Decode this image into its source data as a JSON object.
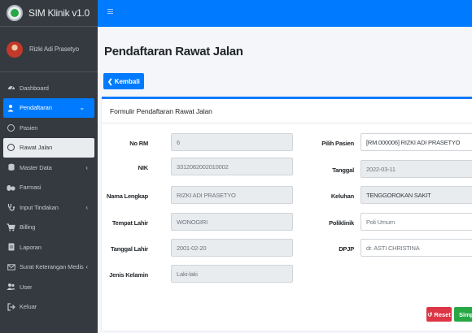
{
  "app": {
    "title": "SIM Klinik v1.0"
  },
  "user": {
    "name": "Rizki Adi Prasetyo"
  },
  "sidebar": {
    "items": [
      {
        "label": "Dashboard",
        "icon": "gauge-icon"
      },
      {
        "label": "Pendaftaran",
        "icon": "user-plus-icon"
      },
      {
        "label": "Pasien",
        "icon": "circle-icon"
      },
      {
        "label": "Rawat Jalan",
        "icon": "circle-icon"
      },
      {
        "label": "Master Data",
        "icon": "database-icon"
      },
      {
        "label": "Farmasi",
        "icon": "pills-icon"
      },
      {
        "label": "Input Tindakan",
        "icon": "stethoscope-icon"
      },
      {
        "label": "Billing",
        "icon": "cart-icon"
      },
      {
        "label": "Laporan",
        "icon": "file-icon"
      },
      {
        "label": "Surat Keterangan Medis",
        "icon": "envelope-icon"
      },
      {
        "label": "User",
        "icon": "users-icon"
      },
      {
        "label": "Keluar",
        "icon": "sign-out-icon"
      }
    ]
  },
  "page": {
    "title": "Pendaftaran Rawat Jalan",
    "back_label": "Kembali"
  },
  "form": {
    "header": "Formulir Pendaftaran Rawat Jalan",
    "left": [
      {
        "label": "No RM",
        "value": "6"
      },
      {
        "label": "NIK",
        "value": "3312082002010002"
      },
      {
        "label": "Nama Lengkap",
        "value": "RIZKI ADI PRASETYO"
      },
      {
        "label": "Tempat Lahir",
        "value": "WONOGIRI"
      },
      {
        "label": "Tanggal Lahir",
        "value": "2001-02-20"
      },
      {
        "label": "Jenis Kelamin",
        "value": "Laki-laki"
      }
    ],
    "right": [
      {
        "label": "Pilih Pasien",
        "value": "[RM.000006] RIZKI ADI PRASETYO"
      },
      {
        "label": "Tanggal",
        "value": "2022-03-11"
      },
      {
        "label": "Keluhan",
        "value": "TENGGOROKAN SAKIT"
      },
      {
        "label": "Poliklinik",
        "value": "Poli Umum"
      },
      {
        "label": "DPJP",
        "value": "dr. ASTI CHRISTINA"
      }
    ],
    "reset_label": "Reset",
    "save_label": "Simpan"
  },
  "colors": {
    "primary": "#007bff",
    "sidebar": "#343a40",
    "danger": "#dc3545",
    "success": "#28a745"
  }
}
